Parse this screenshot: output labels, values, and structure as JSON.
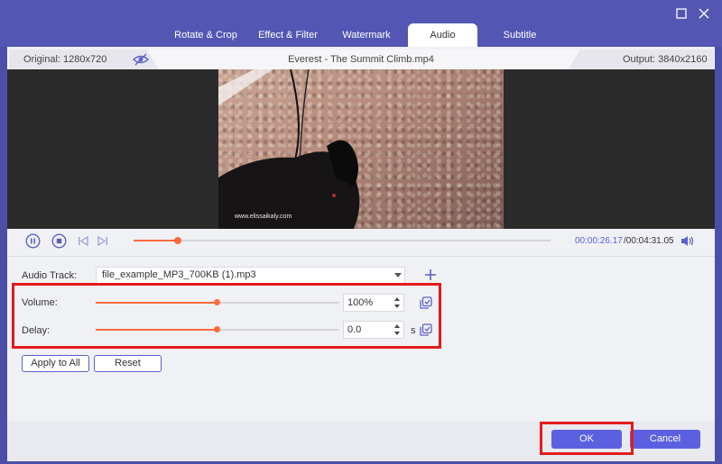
{
  "tabs": [
    {
      "label": "Rotate & Crop",
      "active": false
    },
    {
      "label": "Effect & Filter",
      "active": false
    },
    {
      "label": "Watermark",
      "active": false
    },
    {
      "label": "Audio",
      "active": true
    },
    {
      "label": "Subtitle",
      "active": false
    }
  ],
  "window": {
    "maximize_icon": "maximize-icon",
    "close_icon": "close-icon"
  },
  "info": {
    "original": "Original: 1280x720",
    "filename": "Everest - The Summit Climb.mp4",
    "output": "Output: 3840x2160",
    "preview_icon": "eye-slash-icon"
  },
  "video": {
    "watermark": "www.elissaikaly.com"
  },
  "playback": {
    "current_time": "00:00:26.17",
    "total_time": "/00:04:31.05",
    "progress": 0.106,
    "icons": [
      "pause-icon",
      "stop-icon",
      "prev-frame-icon",
      "next-frame-icon",
      "volume-icon"
    ]
  },
  "audio_track": {
    "label": "Audio Track:",
    "value": "file_example_MP3_700KB (1).mp3"
  },
  "volume": {
    "label": "Volume:",
    "value": "100%",
    "level": 0.5
  },
  "delay": {
    "label": "Delay:",
    "value": "0.0",
    "unit": "s",
    "level": 0.5
  },
  "buttons": {
    "apply_all": "Apply to All",
    "reset": "Reset",
    "ok": "OK",
    "cancel": "Cancel"
  },
  "colors": {
    "accent": "#5b60e0",
    "slider": "#ff6a3d",
    "highlight": "#e31b1b",
    "frame": "#4b4fa8"
  }
}
